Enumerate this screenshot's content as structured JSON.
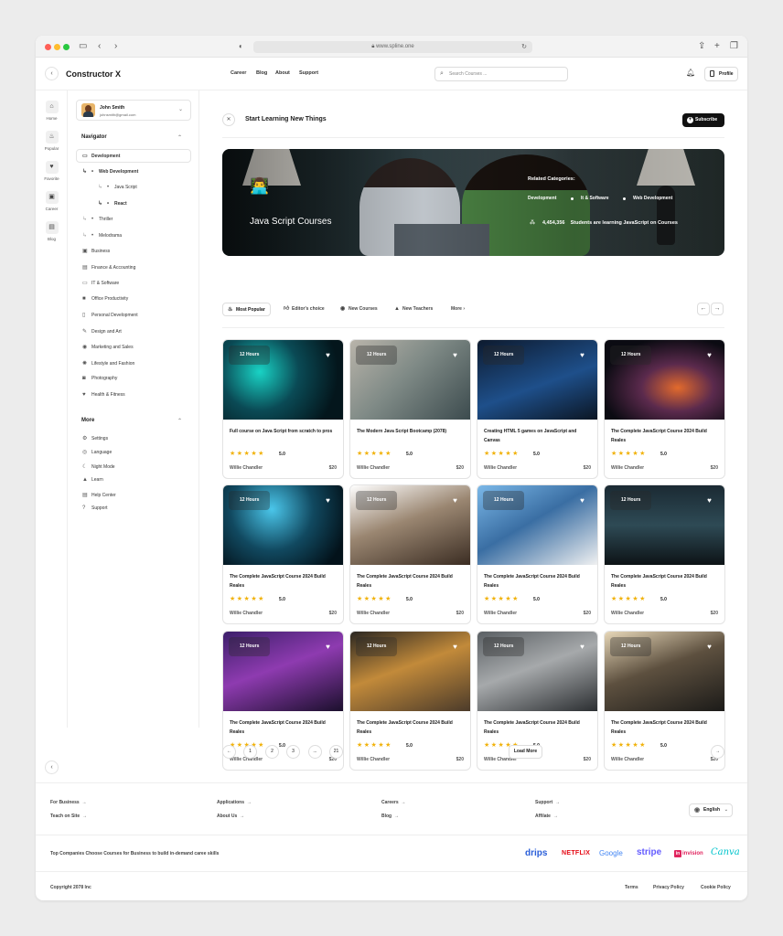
{
  "browser": {
    "url": "www.spline.one"
  },
  "brand": "Constructor X",
  "top_nav": [
    "Career",
    "Blog",
    "About",
    "Support"
  ],
  "search": {
    "placeholder": "Search Courses ..."
  },
  "profile_label": "Profile",
  "rail": [
    {
      "label": "Home",
      "icon": "home-icon"
    },
    {
      "label": "Popular",
      "icon": "fire-icon"
    },
    {
      "label": "Favorite",
      "icon": "heart-icon"
    },
    {
      "label": "Career",
      "icon": "briefcase-icon"
    },
    {
      "label": "Blog",
      "icon": "document-icon"
    }
  ],
  "user": {
    "name": "John Smith",
    "email": "johnsmith@gmail.com"
  },
  "navigator": {
    "title": "Navigator",
    "active": "Development",
    "tree": [
      "Web Development",
      "Java Script",
      "React",
      "Thriller",
      "Melodrama"
    ],
    "categories": [
      "Business",
      "Finance & Accounting",
      "IT & Software",
      "Office Productivity",
      "Personal Development",
      "Design and Art",
      "Marketing and Sales",
      "Lifestyle and Fashion",
      "Photography",
      "Health & Fitness"
    ]
  },
  "more": {
    "title": "More",
    "items": [
      "Settings",
      "Language",
      "Night Mode",
      "Learn",
      "Help Center",
      "Support"
    ]
  },
  "header": {
    "title": "Start Learning New Things",
    "subscribe": "Subscribe"
  },
  "hero": {
    "title": "Java Script Courses",
    "related_label": "Related Categories:",
    "categories": [
      "Development",
      "It & Software",
      "Web Development"
    ],
    "count": "4,454,356",
    "count_text": "Students are learning JavaScript on Courses"
  },
  "tabs": [
    "Most Popular",
    "Editor's choice",
    "New Courses",
    "New Teachers",
    "More"
  ],
  "courses": [
    {
      "hours": "12 Hours",
      "title": "Full course on Java Script from scratch to pros",
      "rating": "5.0",
      "author": "Willie Chandler",
      "price": "$20"
    },
    {
      "hours": "12 Hours",
      "title": "The Modern Java Script Bootcamp (2078)",
      "rating": "5.0",
      "author": "Willie Chandler",
      "price": "$20"
    },
    {
      "hours": "12 Hours",
      "title": "Creating HTML 5 games on JavaScript and Canvas",
      "rating": "5.0",
      "author": "Willie Chandler",
      "price": "$20"
    },
    {
      "hours": "12 Hours",
      "title": "The Complete JavaScript Course 2024 Build Reales",
      "rating": "5.0",
      "author": "Willie Chandler",
      "price": "$20"
    },
    {
      "hours": "12 Hours",
      "title": "The Complete JavaScript Course 2024 Build Reales",
      "rating": "5.0",
      "author": "Willie Chandler",
      "price": "$20"
    },
    {
      "hours": "12 Hours",
      "title": "The Complete JavaScript Course 2024 Build Reales",
      "rating": "5.0",
      "author": "Willie Chandler",
      "price": "$20"
    },
    {
      "hours": "12 Hours",
      "title": "The Complete JavaScript Course 2024 Build Reales",
      "rating": "5.0",
      "author": "Willie Chandler",
      "price": "$20"
    },
    {
      "hours": "12 Hours",
      "title": "The Complete JavaScript Course 2024 Build Reales",
      "rating": "5.0",
      "author": "Willie Chandler",
      "price": "$20"
    },
    {
      "hours": "12 Hours",
      "title": "The Complete JavaScript Course 2024 Build Reales",
      "rating": "5.0",
      "author": "Willie Chandler",
      "price": "$20"
    },
    {
      "hours": "12 Hours",
      "title": "The Complete JavaScript Course 2024 Build Reales",
      "rating": "5.0",
      "author": "Willie Chandler",
      "price": "$20"
    },
    {
      "hours": "12 Hours",
      "title": "The Complete JavaScript Course 2024 Build Reales",
      "rating": "5.0",
      "author": "Willie Chandler",
      "price": "$20"
    },
    {
      "hours": "12 Hours",
      "title": "The Complete JavaScript Course 2024 Build Reales",
      "rating": "5.0",
      "author": "Willie Chandler",
      "price": "$20"
    }
  ],
  "stars": "★★★★★",
  "pagination": [
    "1",
    "2",
    "3",
    "...",
    "21"
  ],
  "load_more": "Load More",
  "footer": {
    "links": [
      "For Business",
      "Teach on Site",
      "Applications",
      "About Us",
      "Careers",
      "Blog",
      "Support",
      "Affilate"
    ],
    "language": "English",
    "companies_text": "Top Companies Choose Courses for Business to build in-demand caree skills",
    "logos": [
      "drips",
      "NETFLIX",
      "Google",
      "stripe",
      "invision",
      "Canva"
    ],
    "copyright": "Copyright 2078 Inc",
    "legal": [
      "Terms",
      "Privacy Policy",
      "Cookie Policy"
    ]
  },
  "colors": {
    "star": "#f1b20b",
    "netflix": "#e50914",
    "stripe": "#635bff",
    "drips": "#2b5fd9",
    "invision": "#e0245e",
    "canva": "#00c4cc"
  }
}
